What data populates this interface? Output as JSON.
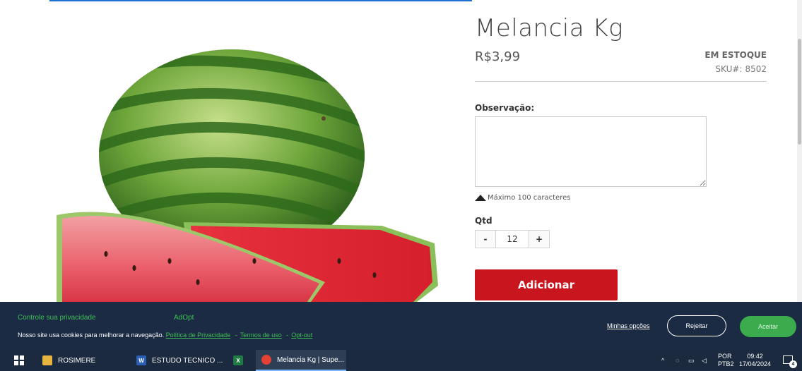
{
  "product": {
    "title": "Melancia Kg",
    "price": "R$3,99",
    "stock": "EM ESTOQUE",
    "sku_label": "SKU#:",
    "sku_value": "8502",
    "image_icon": "watermelon-image"
  },
  "observation": {
    "label": "Observação:",
    "value": "",
    "max_chars": "Máximo 100 caracteres"
  },
  "quantity": {
    "label": "Qtd",
    "minus": "-",
    "value": "12",
    "plus": "+"
  },
  "add_button": "Adicionar",
  "cookie": {
    "title": "Controle sua privacidade",
    "brand": "AdOpt",
    "text": "Nosso site usa cookies para melhorar a navegação.",
    "privacy_link": "Política de Privacidade",
    "sep1": "-",
    "terms_link": "Termos de uso",
    "sep2": "-",
    "optout_link": "Opt-out",
    "options": "Minhas opções",
    "reject": "Rejeitar",
    "accept": "Aceitar"
  },
  "taskbar": {
    "items": [
      {
        "label": "ROSIMERE",
        "icon": "folder-icon"
      },
      {
        "label": "ESTUDO TECNICO ...",
        "icon": "word-icon"
      },
      {
        "label": "",
        "icon": "excel-icon"
      },
      {
        "label": "Melancia Kg | Supe...",
        "icon": "chrome-icon"
      }
    ],
    "lang_1": "POR",
    "lang_2": "PTB2",
    "time": "09:42",
    "date": "17/04/2024",
    "notif_count": "4"
  },
  "colors": {
    "accent_red": "#c8151e",
    "cookie_bg": "#1c2b44",
    "cookie_green": "#3fbf55",
    "taskbar_bg": "#1b2a3e"
  }
}
